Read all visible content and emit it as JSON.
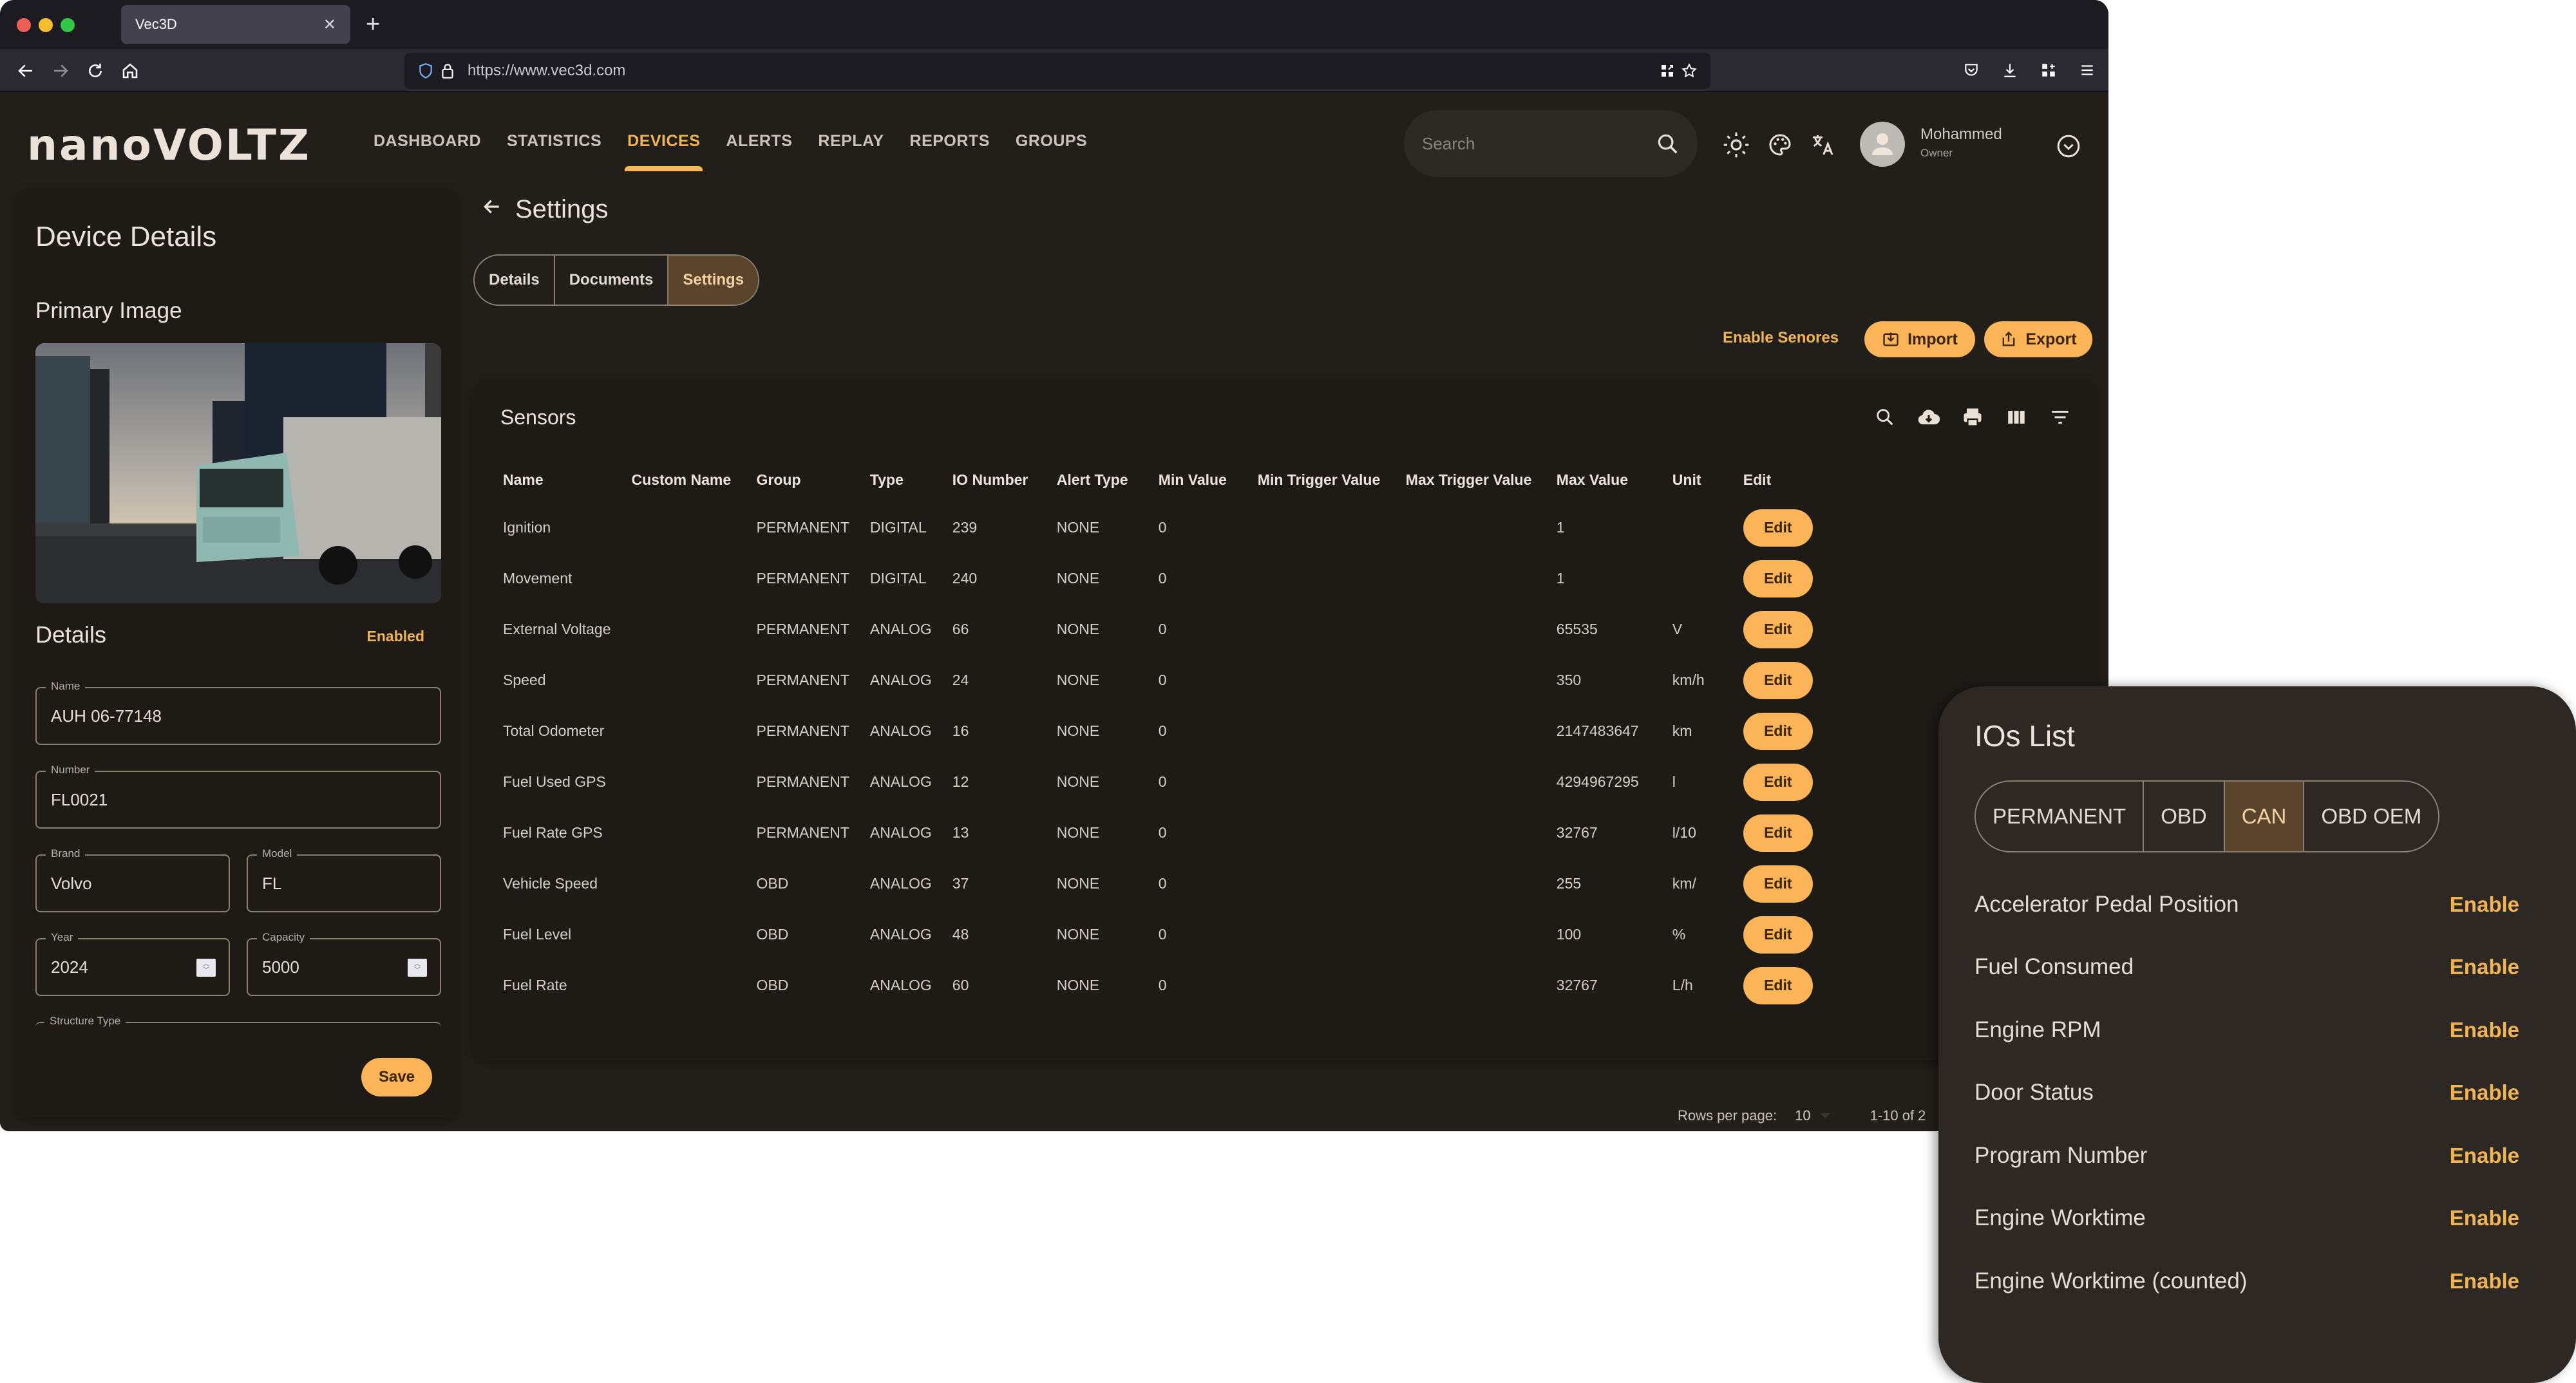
{
  "browser": {
    "tab_title": "Vec3D",
    "url": "https://www.vec3d.com"
  },
  "header": {
    "logo": "nanoVOLTZ",
    "nav": [
      {
        "label": "DASHBOARD",
        "active": false
      },
      {
        "label": "STATISTICS",
        "active": false
      },
      {
        "label": "DEVICES",
        "active": true
      },
      {
        "label": "ALERTS",
        "active": false
      },
      {
        "label": "REPLAY",
        "active": false
      },
      {
        "label": "REPORTS",
        "active": false
      },
      {
        "label": "GROUPS",
        "active": false
      }
    ],
    "search_placeholder": "Search",
    "user": {
      "name": "Mohammed",
      "role": "Owner"
    }
  },
  "device": {
    "title": "Device Details",
    "primary_image_label": "Primary Image",
    "details_label": "Details",
    "status": "Enabled",
    "fields": {
      "name": {
        "label": "Name",
        "value": "AUH 06-77148"
      },
      "number": {
        "label": "Number",
        "value": "FL0021"
      },
      "brand": {
        "label": "Brand",
        "value": "Volvo"
      },
      "model": {
        "label": "Model",
        "value": "FL"
      },
      "year": {
        "label": "Year",
        "value": "2024"
      },
      "capacity": {
        "label": "Capacity",
        "value": "5000"
      },
      "structure_type": {
        "label": "Structure Type",
        "value": ""
      }
    },
    "save_label": "Save"
  },
  "main": {
    "page_title": "Settings",
    "tabs": [
      {
        "label": "Details",
        "active": false
      },
      {
        "label": "Documents",
        "active": false
      },
      {
        "label": "Settings",
        "active": true
      }
    ],
    "actions": {
      "enable_sensors": "Enable Senores",
      "import": "Import",
      "export": "Export"
    },
    "sensors": {
      "title": "Sensors",
      "columns": [
        "Name",
        "Custom Name",
        "Group",
        "Type",
        "IO Number",
        "Alert Type",
        "Min Value",
        "Min Trigger Value",
        "Max Trigger Value",
        "Max Value",
        "Unit",
        "Edit"
      ],
      "edit_label": "Edit",
      "rows": [
        {
          "name": "Ignition",
          "custom_name": "",
          "group": "PERMANENT",
          "type": "DIGITAL",
          "io": "239",
          "alert": "NONE",
          "min": "0",
          "min_trigger": "",
          "max_trigger": "",
          "max": "1",
          "unit": ""
        },
        {
          "name": "Movement",
          "custom_name": "",
          "group": "PERMANENT",
          "type": "DIGITAL",
          "io": "240",
          "alert": "NONE",
          "min": "0",
          "min_trigger": "",
          "max_trigger": "",
          "max": "1",
          "unit": ""
        },
        {
          "name": "External Voltage",
          "custom_name": "",
          "group": "PERMANENT",
          "type": "ANALOG",
          "io": "66",
          "alert": "NONE",
          "min": "0",
          "min_trigger": "",
          "max_trigger": "",
          "max": "65535",
          "unit": "V"
        },
        {
          "name": "Speed",
          "custom_name": "",
          "group": "PERMANENT",
          "type": "ANALOG",
          "io": "24",
          "alert": "NONE",
          "min": "0",
          "min_trigger": "",
          "max_trigger": "",
          "max": "350",
          "unit": "km/h"
        },
        {
          "name": "Total Odometer",
          "custom_name": "",
          "group": "PERMANENT",
          "type": "ANALOG",
          "io": "16",
          "alert": "NONE",
          "min": "0",
          "min_trigger": "",
          "max_trigger": "",
          "max": "2147483647",
          "unit": "km"
        },
        {
          "name": "Fuel Used GPS",
          "custom_name": "",
          "group": "PERMANENT",
          "type": "ANALOG",
          "io": "12",
          "alert": "NONE",
          "min": "0",
          "min_trigger": "",
          "max_trigger": "",
          "max": "4294967295",
          "unit": "l"
        },
        {
          "name": "Fuel Rate GPS",
          "custom_name": "",
          "group": "PERMANENT",
          "type": "ANALOG",
          "io": "13",
          "alert": "NONE",
          "min": "0",
          "min_trigger": "",
          "max_trigger": "",
          "max": "32767",
          "unit": "l/10"
        },
        {
          "name": "Vehicle Speed",
          "custom_name": "",
          "group": "OBD",
          "type": "ANALOG",
          "io": "37",
          "alert": "NONE",
          "min": "0",
          "min_trigger": "",
          "max_trigger": "",
          "max": "255",
          "unit": "km/"
        },
        {
          "name": "Fuel Level",
          "custom_name": "",
          "group": "OBD",
          "type": "ANALOG",
          "io": "48",
          "alert": "NONE",
          "min": "0",
          "min_trigger": "",
          "max_trigger": "",
          "max": "100",
          "unit": "%"
        },
        {
          "name": "Fuel Rate",
          "custom_name": "",
          "group": "OBD",
          "type": "ANALOG",
          "io": "60",
          "alert": "NONE",
          "min": "0",
          "min_trigger": "",
          "max_trigger": "",
          "max": "32767",
          "unit": "L/h"
        }
      ],
      "pagination": {
        "rows_per_page_label": "Rows per page:",
        "rows_per_page": "10",
        "range": "1-10 of 2"
      }
    }
  },
  "ios_panel": {
    "title": "IOs List",
    "groups": [
      {
        "label": "PERMANENT",
        "active": false
      },
      {
        "label": "OBD",
        "active": false
      },
      {
        "label": "CAN",
        "active": true
      },
      {
        "label": "OBD OEM",
        "active": false
      }
    ],
    "enable_label": "Enable",
    "items": [
      "Accelerator Pedal Position",
      "Fuel Consumed",
      "Engine RPM",
      "Door Status",
      "Program Number",
      "Engine Worktime",
      "Engine Worktime (counted)"
    ]
  },
  "colors": {
    "accent": "#fbb457",
    "accent_text": "#f1b455",
    "background": "#221f1a",
    "card": "#1e1b17",
    "segment_active": "#5a452c"
  }
}
